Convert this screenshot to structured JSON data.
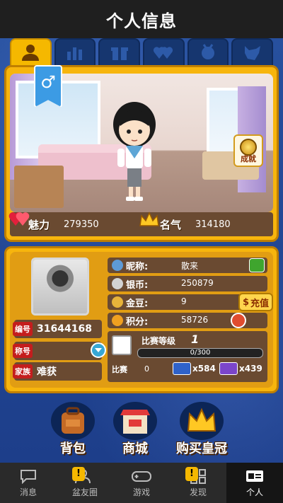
{
  "header": {
    "title": "个人信息"
  },
  "tabs": [
    {
      "icon": "person-icon",
      "active": true
    },
    {
      "icon": "bar-chart-icon",
      "active": false
    },
    {
      "icon": "gift-icon",
      "active": false
    },
    {
      "icon": "hearts-icon",
      "active": false
    },
    {
      "icon": "medal-icon",
      "active": false
    },
    {
      "icon": "wolf-icon",
      "active": false
    }
  ],
  "room": {
    "achievement_label": "成就",
    "stats": [
      {
        "label": "魅力",
        "value": "279350",
        "icon": "hearts-icon"
      },
      {
        "label": "名气",
        "value": "314180",
        "icon": "crown-icon"
      }
    ]
  },
  "profile": {
    "id_tag": "编号",
    "id_value": "31644168",
    "title_tag": "称号",
    "title_value": "",
    "family_tag": "家族",
    "family_value": "难获",
    "nickname_label": "昵称:",
    "nickname_value": "散来",
    "silver_label": "银币:",
    "silver_value": "250879",
    "gold_label": "金豆:",
    "gold_value": "9",
    "charge_label": "充值",
    "score_label": "积分:",
    "score_value": "58726",
    "match_label": "比赛等级",
    "match_level": "1",
    "match_progress_text": "0/300",
    "match_progress": 0,
    "match_count_label": "比赛",
    "match_count_value": "0",
    "item1_value": "x584",
    "item2_value": "x439"
  },
  "actions": [
    {
      "label": "背包",
      "icon": "backpack-icon"
    },
    {
      "label": "商城",
      "icon": "shop-icon"
    },
    {
      "label": "购买皇冠",
      "icon": "crown-icon"
    }
  ],
  "nav": [
    {
      "label": "消息",
      "icon": "chat-icon",
      "alert": false,
      "active": false
    },
    {
      "label": "盆友圈",
      "icon": "friends-icon",
      "alert": true,
      "active": false
    },
    {
      "label": "游戏",
      "icon": "gamepad-icon",
      "alert": false,
      "active": false
    },
    {
      "label": "发现",
      "icon": "grid-icon",
      "alert": true,
      "active": false
    },
    {
      "label": "个人",
      "icon": "id-card-icon",
      "alert": false,
      "active": true
    }
  ],
  "colors": {
    "frame": "#f7b50d",
    "panel": "#6a4a31",
    "bg": "#1d3e8a"
  }
}
